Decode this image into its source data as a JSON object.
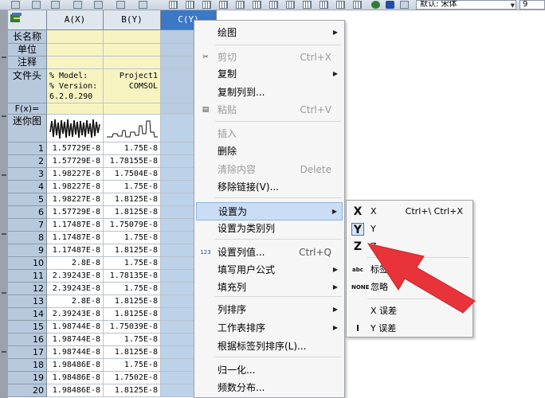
{
  "toolbar": {
    "font_value": "默认: 宋体",
    "size_value": "9"
  },
  "sheet": {
    "columns": [
      {
        "label": "A(X)"
      },
      {
        "label": "B(Y)"
      },
      {
        "label": "C(Y)"
      }
    ],
    "meta_rows": {
      "long_name": "长名称",
      "units": "单位",
      "comments": "注释",
      "file_header": "文件头",
      "formula": "F(x)=",
      "sparkline": "迷你图"
    },
    "file_header_lines": [
      "% Model:",
      "% Version:",
      "6.2.0.290"
    ],
    "file_header_b": [
      "Project1",
      "COMSOL"
    ],
    "rows": [
      {
        "n": "1",
        "a": "1.57729E-8",
        "b": "1.75E-8"
      },
      {
        "n": "2",
        "a": "1.57729E-8",
        "b": "1.78155E-8"
      },
      {
        "n": "3",
        "a": "1.98227E-8",
        "b": "1.7504E-8"
      },
      {
        "n": "4",
        "a": "1.98227E-8",
        "b": "1.75E-8"
      },
      {
        "n": "5",
        "a": "1.98227E-8",
        "b": "1.8125E-8"
      },
      {
        "n": "6",
        "a": "1.57729E-8",
        "b": "1.8125E-8"
      },
      {
        "n": "7",
        "a": "1.17487E-8",
        "b": "1.75079E-8"
      },
      {
        "n": "8",
        "a": "1.17487E-8",
        "b": "1.75E-8"
      },
      {
        "n": "9",
        "a": "1.17487E-8",
        "b": "1.8125E-8"
      },
      {
        "n": "10",
        "a": "2.8E-8",
        "b": "1.75E-8"
      },
      {
        "n": "11",
        "a": "2.39243E-8",
        "b": "1.78135E-8"
      },
      {
        "n": "12",
        "a": "2.39243E-8",
        "b": "1.75E-8"
      },
      {
        "n": "13",
        "a": "2.8E-8",
        "b": "1.8125E-8"
      },
      {
        "n": "14",
        "a": "2.39243E-8",
        "b": "1.8125E-8"
      },
      {
        "n": "15",
        "a": "1.98744E-8",
        "b": "1.75039E-8"
      },
      {
        "n": "16",
        "a": "1.98744E-8",
        "b": "1.75E-8"
      },
      {
        "n": "17",
        "a": "1.98744E-8",
        "b": "1.8125E-8"
      },
      {
        "n": "18",
        "a": "1.98486E-8",
        "b": "1.75E-8"
      },
      {
        "n": "19",
        "a": "1.98486E-8",
        "b": "1.7502E-8"
      },
      {
        "n": "20",
        "a": "1.98486E-8",
        "b": "1.8125E-8"
      }
    ]
  },
  "menu": {
    "items": [
      {
        "label": "绘图",
        "shortcut": "",
        "submenu": true,
        "disabled": false,
        "icon": ""
      },
      {
        "label": "剪切",
        "shortcut": "Ctrl+X",
        "submenu": false,
        "disabled": true,
        "icon": "scissors-icon"
      },
      {
        "label": "复制",
        "shortcut": "",
        "submenu": true,
        "disabled": false,
        "icon": ""
      },
      {
        "label": "复制列到...",
        "shortcut": "",
        "submenu": false,
        "disabled": false,
        "icon": ""
      },
      {
        "label": "粘贴",
        "shortcut": "Ctrl+V",
        "submenu": false,
        "disabled": true,
        "icon": "paste-icon"
      },
      {
        "label": "插入",
        "shortcut": "",
        "submenu": false,
        "disabled": true,
        "icon": ""
      },
      {
        "label": "删除",
        "shortcut": "",
        "submenu": false,
        "disabled": false,
        "icon": ""
      },
      {
        "label": "清除内容",
        "shortcut": "Delete",
        "submenu": false,
        "disabled": true,
        "icon": ""
      },
      {
        "label": "移除链接(V)...",
        "shortcut": "",
        "submenu": false,
        "disabled": false,
        "icon": ""
      },
      {
        "label": "设置为",
        "shortcut": "",
        "submenu": true,
        "disabled": false,
        "icon": ""
      },
      {
        "label": "设置为类别列",
        "shortcut": "",
        "submenu": false,
        "disabled": false,
        "icon": ""
      },
      {
        "label": "设置列值...",
        "shortcut": "Ctrl+Q",
        "submenu": false,
        "disabled": false,
        "icon": "set-values-icon"
      },
      {
        "label": "填写用户公式",
        "shortcut": "",
        "submenu": true,
        "disabled": false,
        "icon": ""
      },
      {
        "label": "填充列",
        "shortcut": "",
        "submenu": true,
        "disabled": false,
        "icon": ""
      },
      {
        "label": "列排序",
        "shortcut": "",
        "submenu": true,
        "disabled": false,
        "icon": ""
      },
      {
        "label": "工作表排序",
        "shortcut": "",
        "submenu": true,
        "disabled": false,
        "icon": ""
      },
      {
        "label": "根据标签列排序(L)...",
        "shortcut": "",
        "submenu": false,
        "disabled": false,
        "icon": ""
      },
      {
        "label": "归一化...",
        "shortcut": "",
        "submenu": false,
        "disabled": false,
        "icon": ""
      },
      {
        "label": "频数分布...",
        "shortcut": "",
        "submenu": false,
        "disabled": false,
        "icon": ""
      }
    ],
    "highlighted": "设置为"
  },
  "submenu": {
    "items": [
      {
        "label": "X",
        "shortcut": "Ctrl+\\ Ctrl+X",
        "icon": "x-icon",
        "glyph": "X"
      },
      {
        "label": "Y",
        "shortcut": "",
        "icon": "y-icon",
        "glyph": "Y"
      },
      {
        "label": "Z",
        "shortcut": "",
        "icon": "z-icon",
        "glyph": "Z"
      },
      {
        "label": "标签",
        "shortcut": "",
        "icon": "label-icon",
        "glyph": "abc"
      },
      {
        "label": "忽略",
        "shortcut": "",
        "icon": "ignore-icon",
        "glyph": "NONE"
      },
      {
        "label": "X 误差",
        "shortcut": "",
        "icon": "",
        "glyph": ""
      },
      {
        "label": "Y 误差",
        "shortcut": "",
        "icon": "y-error-icon",
        "glyph": "I"
      }
    ]
  },
  "colors": {
    "selected_header": "#3b78c6",
    "selected_column": "#bcd2e8",
    "meta_row": "#f7f4c2",
    "menu_highlight": "#c9def5",
    "annotation_arrow": "#e8333a"
  }
}
